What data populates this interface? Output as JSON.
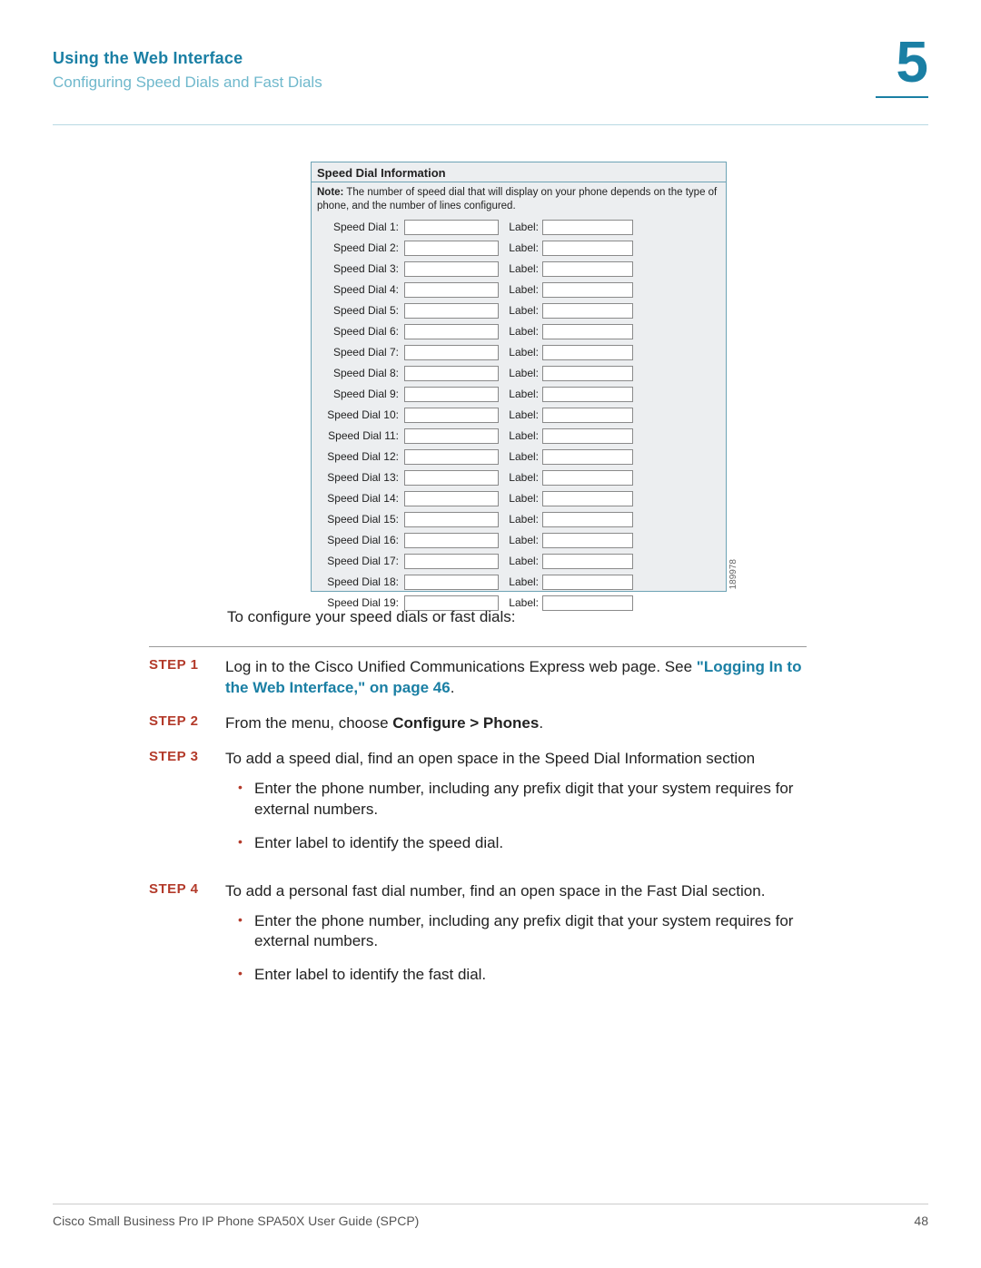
{
  "header": {
    "title": "Using the Web Interface",
    "subtitle": "Configuring Speed Dials and Fast Dials",
    "chapter": "5"
  },
  "screenshot": {
    "panel_title": "Speed Dial Information",
    "note_bold": "Note:",
    "note_text": " The number of speed dial that will display on your phone depends on the type of phone, and the number of lines configured.",
    "label_text": "Label:",
    "rows": [
      "Speed Dial 1:",
      "Speed Dial 2:",
      "Speed Dial 3:",
      "Speed Dial 4:",
      "Speed Dial 5:",
      "Speed Dial 6:",
      "Speed Dial 7:",
      "Speed Dial 8:",
      "Speed Dial 9:",
      "Speed Dial 10:",
      "Speed Dial 11:",
      "Speed Dial 12:",
      "Speed Dial 13:",
      "Speed Dial 14:",
      "Speed Dial 15:",
      "Speed Dial 16:",
      "Speed Dial 17:",
      "Speed Dial 18:",
      "Speed Dial 19:"
    ],
    "side_id": "189978"
  },
  "intro": "To configure your speed dials or fast dials:",
  "steps": {
    "s1": {
      "label": "STEP 1",
      "pre": "Log in to the Cisco Unified Communications Express web page. See ",
      "link": "\"Logging In to the Web Interface,\" on page 46",
      "post": "."
    },
    "s2": {
      "label": "STEP 2",
      "pre": "From the menu, choose ",
      "bold": "Configure > Phones",
      "post": "."
    },
    "s3": {
      "label": "STEP 3",
      "text": "To add a speed dial, find an open space in the Speed Dial Information section",
      "b1": "Enter the phone number, including any prefix digit that your system requires for external numbers.",
      "b2": "Enter label to identify the speed dial."
    },
    "s4": {
      "label": "STEP 4",
      "text": "To add a personal fast dial number, find an open space in the Fast Dial section.",
      "b1": "Enter the phone number, including any prefix digit that your system requires for external numbers.",
      "b2": "Enter label to identify the fast dial."
    }
  },
  "footer": {
    "left": "Cisco Small Business Pro IP Phone SPA50X User Guide (SPCP)",
    "right": "48"
  }
}
